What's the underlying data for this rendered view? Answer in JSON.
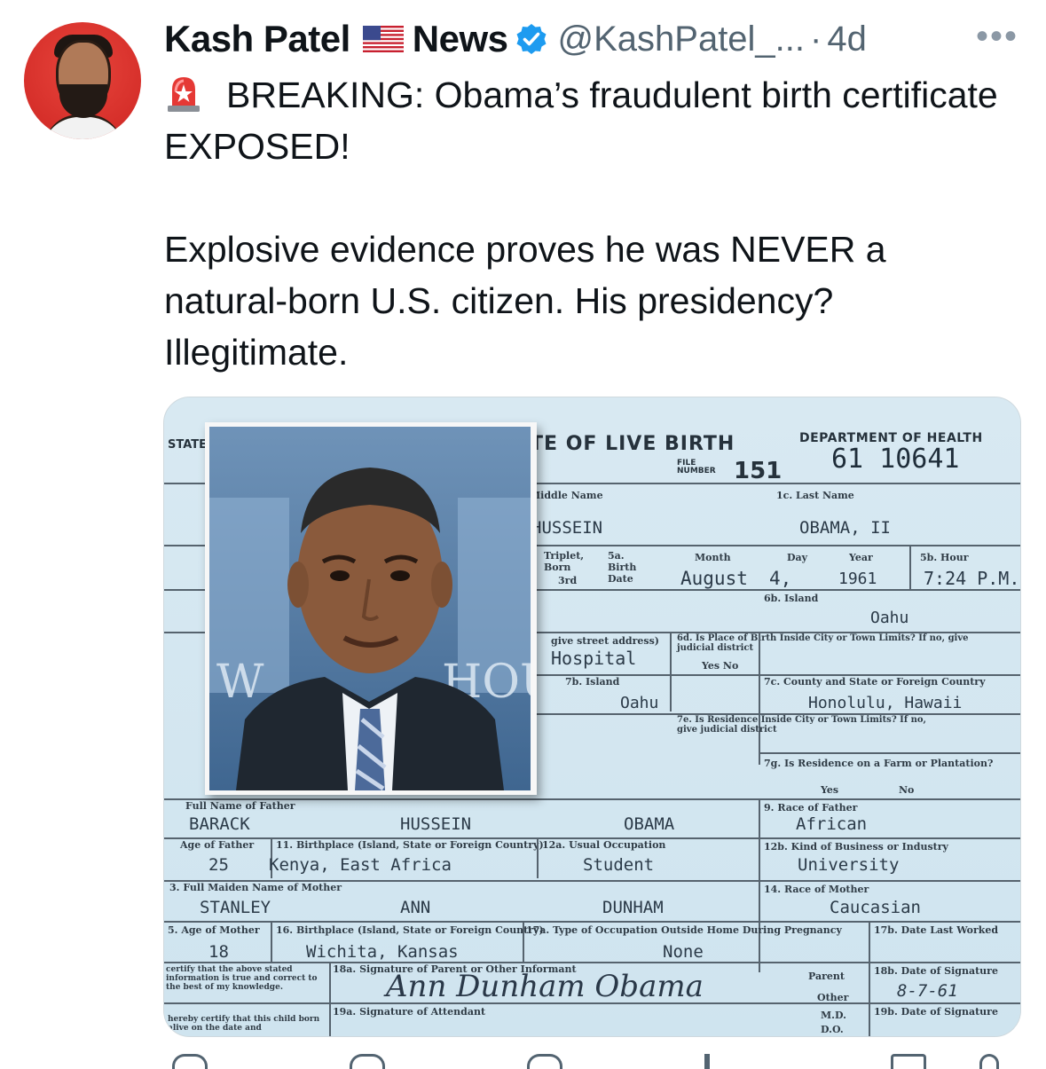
{
  "author": {
    "display_name": "Kash Patel",
    "flag_icon": "us-flag",
    "suffix": "News",
    "verified": true,
    "handle": "@KashPatel_...",
    "separator": "·",
    "time": "4d"
  },
  "more_label": "•••",
  "tweet": {
    "line1": "BREAKING: Obama’s fraudulent birth certificate EXPOSED!",
    "line2": "Explosive evidence proves he was NEVER a natural-born U.S. citizen. His presidency? Illegitimate."
  },
  "certificate": {
    "state_label": "STATE",
    "title": "TE OF LIVE BIRTH",
    "file_label": "FILE NUMBER",
    "file_number": "151",
    "department": "DEPARTMENT OF HEALTH",
    "cert_number": "61 10641",
    "middle_name_label": "Middle Name",
    "middle_name": "HUSSEIN",
    "last_name_label": "1c. Last Name",
    "last_name": "OBAMA, II",
    "triplet_label": "Triplet, Born",
    "third_label": "3rd",
    "birth_date_label": "5a. Birth Date",
    "month_label": "Month",
    "month": "August",
    "day_label": "Day",
    "day": "4,",
    "year_label": "Year",
    "year": "1961",
    "hour_label": "5b. Hour",
    "hour": "7:24 P.M.",
    "island_label": "6b. Island",
    "island": "Oahu",
    "street_label": "give street address)",
    "hospital": "Hospital",
    "place_inside_label": "6d. Is Place of Birth Inside City or Town Limits? If no, give judicial district",
    "yes_no_label": "Yes  No",
    "island2_label": "7b. Island",
    "island2": "Oahu",
    "county_label": "7c. County and State or Foreign Country",
    "county": "Honolulu, Hawaii",
    "residence_inside_label": "7e. Is Residence Inside City or Town Limits? If no, give judicial district",
    "farm_label": "7g. Is Residence on a Farm or Plantation?",
    "yes_label": "Yes",
    "no_label": "No",
    "father_name_label": "Full Name of Father",
    "father_first": "BARACK",
    "father_middle": "HUSSEIN",
    "father_last": "OBAMA",
    "father_race_label": "9. Race of Father",
    "father_race": "African",
    "father_age_label": "Age of Father",
    "father_age": "25",
    "father_birthplace_label": "11. Birthplace (Island, State or Foreign Country)",
    "father_birthplace": "Kenya, East Africa",
    "occupation_label": "12a. Usual Occupation",
    "occupation": "Student",
    "business_label": "12b. Kind of Business or Industry",
    "business": "University",
    "mother_name_label": "3. Full Maiden Name of Mother",
    "mother_first": "STANLEY",
    "mother_middle": "ANN",
    "mother_last": "DUNHAM",
    "mother_race_label": "14. Race of Mother",
    "mother_race": "Caucasian",
    "mother_age_label": "5. Age of Mother",
    "mother_age": "18",
    "mother_birthplace_label": "16. Birthplace (Island, State or Foreign Country)",
    "mother_birthplace": "Wichita, Kansas",
    "occupation_outside_label": "17a. Type of Occupation Outside Home During Pregnancy",
    "occupation_outside": "None",
    "last_worked_label": "17b. Date Last Worked",
    "certify_label": "certify that the above stated information is true and correct to the best of my knowledge.",
    "signature_label": "18a. Signature of Parent or Other Informant",
    "signature": "Ann Dunham Obama",
    "parent_label": "Parent",
    "other_label": "Other",
    "sig_date_label": "18b. Date of Signature",
    "sig_date": "8-7-61",
    "hereby_label": "hereby certify that this child born alive on the date and",
    "attendant_label": "19a. Signature of Attendant",
    "md_label": "M.D.",
    "do_label": "D.O.",
    "sig_date2_label": "19b. Date of Signature",
    "watermark": "HOU",
    "watermark_left": "W"
  }
}
